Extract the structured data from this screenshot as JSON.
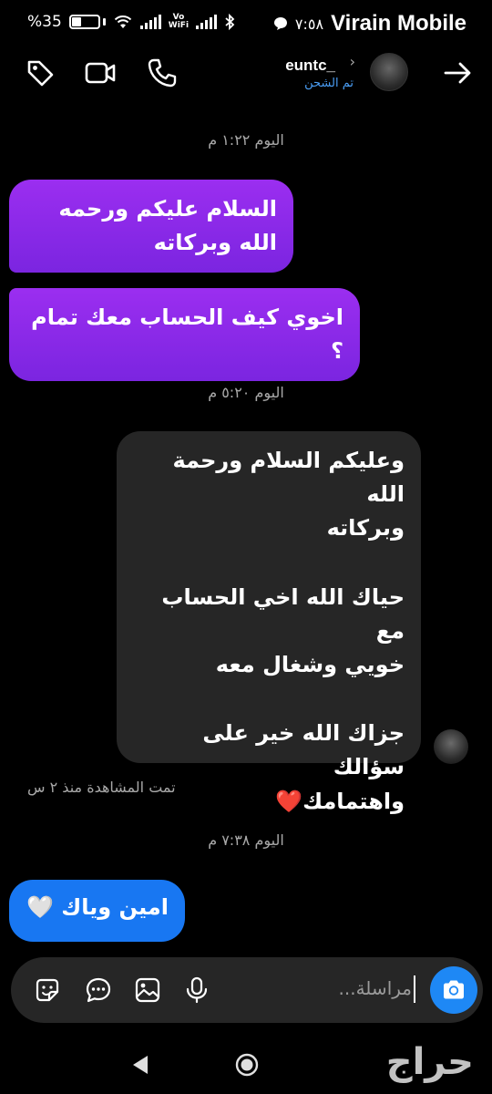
{
  "status_bar": {
    "battery_text": "%35",
    "battery_level": 0.35,
    "vowifi_line1": "Vo",
    "vowifi_line2": "WiFi",
    "time": "٧:٥٨",
    "carrier": "Virain Mobile"
  },
  "header": {
    "username": "euntc_",
    "subtitle": "تم الشحن",
    "chevron": "›"
  },
  "chat": {
    "messages": [
      {
        "type": "date",
        "text": "اليوم ١:٢٢ م"
      },
      {
        "type": "sent",
        "text": "السلام عليكم ورحمه الله وبركاته"
      },
      {
        "type": "sent",
        "text": "اخوي كيف الحساب معك تمام ؟"
      },
      {
        "type": "date",
        "text": "اليوم ٥:٢٠ م"
      },
      {
        "type": "received",
        "line1": "وعليكم السلام ورحمة الله",
        "line2": "وبركاته",
        "line3": "حياك الله اخي الحساب مع",
        "line4": "خويي وشغال معه",
        "line5": "جزاك الله خير على سؤالك",
        "line6": "واهتمامك❤️"
      },
      {
        "type": "seen",
        "text": "تمت المشاهدة منذ ٢ س"
      },
      {
        "type": "date",
        "text": "اليوم ٧:٣٨ م"
      },
      {
        "type": "sent_blue",
        "text": "امين وياك 🤍"
      }
    ]
  },
  "composer": {
    "placeholder": "مراسلة..."
  },
  "watermark": "حراج",
  "icons": {
    "header_left": [
      "tag-icon",
      "video-call-icon",
      "phone-icon"
    ],
    "header_right": [
      "back-arrow-icon"
    ],
    "composer": [
      "sticker-icon",
      "chat-more-icon",
      "gallery-icon",
      "microphone-icon",
      "camera-icon"
    ],
    "nav": [
      "back-nav-icon",
      "home-nav-icon"
    ]
  },
  "colors": {
    "sent_bubble": "#8a2be2",
    "received_bubble": "#262626",
    "sent_blue": "#1877f2",
    "link_blue": "#4a9ef5"
  }
}
